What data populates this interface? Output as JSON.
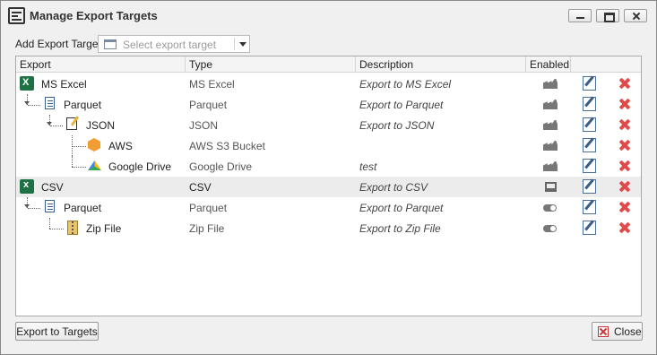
{
  "window": {
    "title": "Manage Export Targets"
  },
  "toolbar": {
    "add_label": "Add Export Target",
    "select_placeholder": "Select export target"
  },
  "grid": {
    "headers": {
      "export": "Export",
      "type": "Type",
      "description": "Description",
      "enabled": "Enabled"
    },
    "rows": [
      {
        "name": "MS Excel",
        "type": "MS Excel",
        "description": "Export to MS Excel",
        "icon": "excel-icon",
        "enabled_icon": "factory-icon",
        "level": 0
      },
      {
        "name": "Parquet",
        "type": "Parquet",
        "description": "Export to Parquet",
        "icon": "document-icon",
        "enabled_icon": "factory-icon",
        "level": 1
      },
      {
        "name": "JSON",
        "type": "JSON",
        "description": "Export to JSON",
        "icon": "json-file-icon",
        "enabled_icon": "factory-icon",
        "level": 2
      },
      {
        "name": "AWS",
        "type": "AWS S3 Bucket",
        "description": "",
        "icon": "aws-icon",
        "enabled_icon": "factory-icon",
        "level": 3
      },
      {
        "name": "Google Drive",
        "type": "Google Drive",
        "description": "test",
        "icon": "google-drive-icon",
        "enabled_icon": "factory-icon",
        "level": 3
      },
      {
        "name": "CSV",
        "type": "CSV",
        "description": "Export to CSV",
        "icon": "csv-icon",
        "enabled_icon": "monitor-icon",
        "level": 0
      },
      {
        "name": "Parquet",
        "type": "Parquet",
        "description": "Export to Parquet",
        "icon": "document-icon",
        "enabled_icon": "toggle-icon",
        "level": 1
      },
      {
        "name": "Zip File",
        "type": "Zip File",
        "description": "Export to Zip File",
        "icon": "zip-icon",
        "enabled_icon": "toggle-icon",
        "level": 2
      }
    ]
  },
  "footer": {
    "export_label": "Export to Targets",
    "close_label": "Close"
  },
  "colors": {
    "accent": "#1e7145",
    "delete": "#e04a4a",
    "selected_row": "#ececec"
  }
}
